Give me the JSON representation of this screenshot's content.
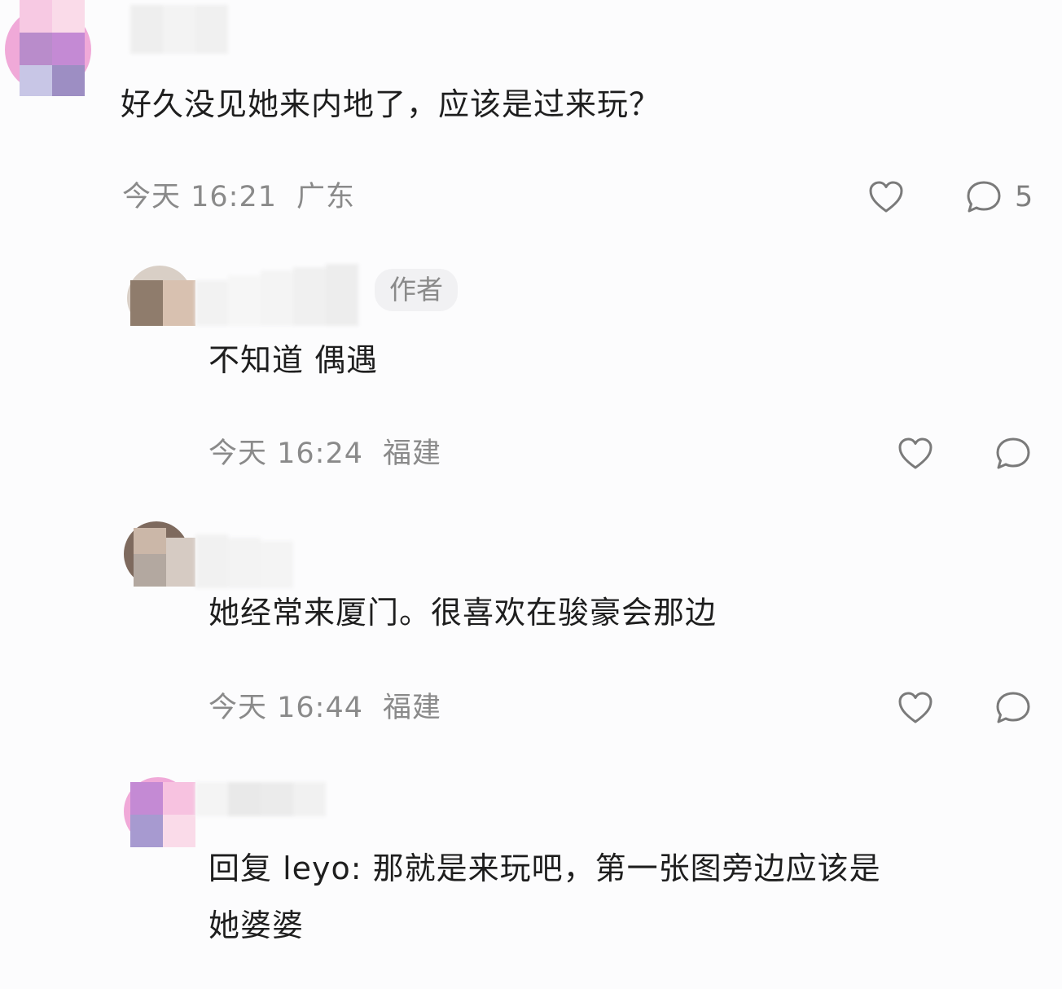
{
  "colors": {
    "background": "#fcfcfd",
    "text": "#1e1e1e",
    "meta": "#8a8a8a",
    "icon_stroke": "#7a7a7a",
    "badge_bg": "#f1f1f3"
  },
  "comments": [
    {
      "text": "好久没见她来内地了，应该是过来玩？",
      "time": "今天 16:21",
      "location": "广东",
      "reply_count": "5",
      "icons": [
        "heart-icon",
        "comment-bubble-icon"
      ]
    },
    {
      "author_badge": "作者",
      "text": "不知道 偶遇",
      "time": "今天 16:24",
      "location": "福建",
      "icons": [
        "heart-icon",
        "comment-bubble-icon"
      ]
    },
    {
      "text": "她经常来厦门。很喜欢在骏豪会那边",
      "time": "今天 16:44",
      "location": "福建",
      "icons": [
        "heart-icon",
        "comment-bubble-icon"
      ]
    },
    {
      "text_line1": "回复 leyo: 那就是来玩吧，第一张图旁边应该是",
      "text_line2": "她婆婆"
    }
  ]
}
